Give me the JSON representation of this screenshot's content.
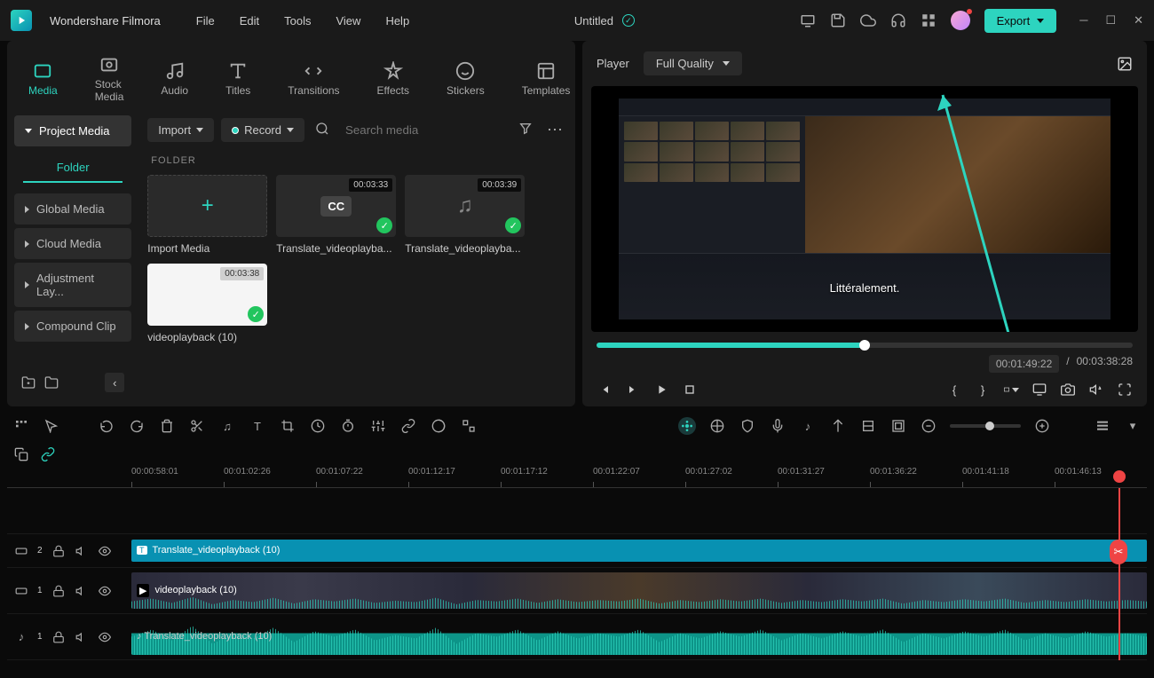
{
  "app": {
    "name": "Wondershare Filmora",
    "document": "Untitled"
  },
  "menu": [
    "File",
    "Edit",
    "Tools",
    "View",
    "Help"
  ],
  "export_label": "Export",
  "tabs": [
    {
      "label": "Media",
      "active": true
    },
    {
      "label": "Stock Media"
    },
    {
      "label": "Audio"
    },
    {
      "label": "Titles"
    },
    {
      "label": "Transitions"
    },
    {
      "label": "Effects"
    },
    {
      "label": "Stickers"
    },
    {
      "label": "Templates"
    }
  ],
  "sidebar": {
    "project_media": "Project Media",
    "folder": "Folder",
    "items": [
      "Global Media",
      "Cloud Media",
      "Adjustment Lay...",
      "Compound Clip"
    ]
  },
  "media_toolbar": {
    "import": "Import",
    "record": "Record",
    "search_placeholder": "Search media"
  },
  "folder_label": "FOLDER",
  "media_items": [
    {
      "label": "Import Media",
      "type": "import"
    },
    {
      "label": "Translate_videoplayba...",
      "type": "cc",
      "duration": "00:03:33"
    },
    {
      "label": "Translate_videoplayba...",
      "type": "music",
      "duration": "00:03:39"
    },
    {
      "label": "videoplayback (10)",
      "type": "video",
      "duration": "00:03:38"
    }
  ],
  "player": {
    "label": "Player",
    "quality": "Full Quality",
    "subtitle": "Littéralement.",
    "current_time": "00:01:49:22",
    "total_time": "00:03:38:28",
    "sep": "/"
  },
  "ruler_ticks": [
    "00:00:58:01",
    "00:01:02:26",
    "00:01:07:22",
    "00:01:12:17",
    "00:01:17:12",
    "00:01:22:07",
    "00:01:27:02",
    "00:01:31:27",
    "00:01:36:22",
    "00:01:41:18",
    "00:01:46:13"
  ],
  "tracks": {
    "text_clip": "Translate_videoplayback (10)",
    "video_clip": "videoplayback (10)",
    "audio_clip": "Translate_videoplayback (10)",
    "text_num": "2",
    "video_num": "1",
    "audio_num": "1"
  }
}
